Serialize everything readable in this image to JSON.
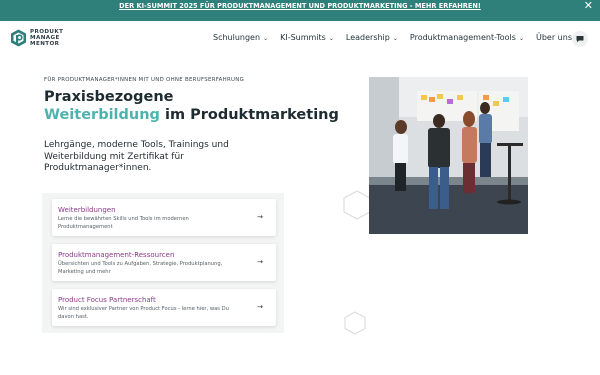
{
  "banner": {
    "text": "DER KI-SUMMIT 2025 FÜR PRODUKTMANAGEMENT UND PRODUKTMARKETING - MEHR ERFAHREN!",
    "close_icon": "close-icon"
  },
  "logo": {
    "line1": "PRODUKT",
    "line2": "MANAGE",
    "line3": "MENTOR"
  },
  "nav": {
    "items": [
      {
        "label": "Schulungen"
      },
      {
        "label": "KI-Summits"
      },
      {
        "label": "Leadership"
      },
      {
        "label": "Produktmanagement-Tools"
      },
      {
        "label": "Über uns"
      }
    ],
    "chat_icon": "chat-icon"
  },
  "hero": {
    "eyebrow": "FÜR PRODUKTMANAGER*INNEN MIT UND OHNE BERUFSERFAHRUNG",
    "headline_line1": "Praxisbezogene",
    "headline_teal": "Weiterbildung",
    "headline_rest": " im Produktmarketing",
    "subtext": "Lehrgänge, moderne Tools, Trainings und Weiterbildung mit Zertifikat für Produktmanager*innen."
  },
  "cards": [
    {
      "title": "Weiterbildungen",
      "desc": "Lerne die bewährten Skills und Tools im modernen Produktmanagement"
    },
    {
      "title": "Produktmanagement-Ressourcen",
      "desc": "Übersichten und Tools zu Aufgaben, Strategie, Produktplanung, Marketing und mehr"
    },
    {
      "title": "Product Focus Partnerschaft",
      "desc": "Wir sind exklusiver Partner von Product Focus - lerne hier, was Du davon hast."
    }
  ],
  "colors": {
    "banner": "#2f7f7b",
    "accent_teal": "#4fb3ad",
    "card_title": "#8b3a8a"
  }
}
